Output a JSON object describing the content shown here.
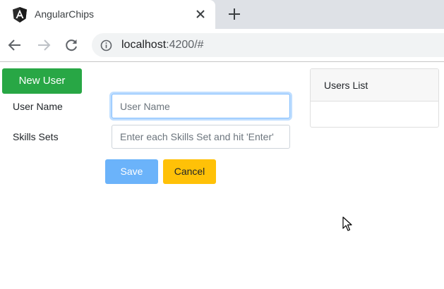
{
  "browser": {
    "tab_title": "AngularChips",
    "url_host": "localhost",
    "url_path": ":4200/#",
    "icons": {
      "favicon": "angular-logo-icon",
      "close": "close-icon",
      "new_tab": "plus-icon",
      "back": "arrow-back-icon",
      "forward": "arrow-forward-icon",
      "reload": "reload-icon",
      "info": "info-icon"
    }
  },
  "page": {
    "new_user_label": "New User",
    "form": {
      "user_name_label": "User Name",
      "user_name_placeholder": "User Name",
      "skills_label": "Skills Sets",
      "skills_placeholder": "Enter each Skills Set and hit 'Enter'",
      "save_label": "Save",
      "cancel_label": "Cancel"
    },
    "users_list": {
      "title": "Users List",
      "items": []
    }
  },
  "colors": {
    "new_user": "#28a745",
    "save": "#6bb3fa",
    "cancel": "#ffc107",
    "angular_red": "#dd0031"
  }
}
